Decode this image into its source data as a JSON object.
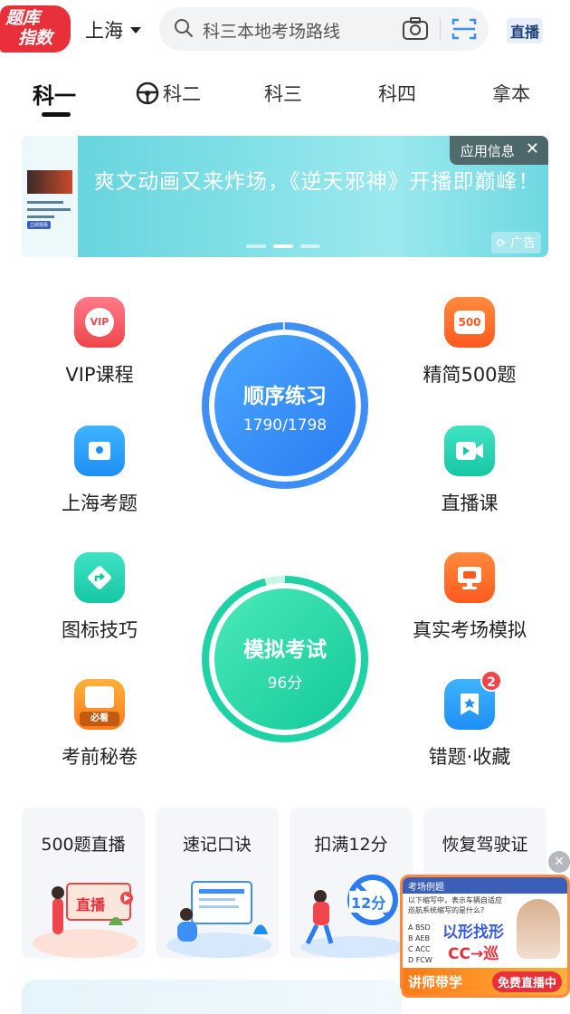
{
  "header": {
    "logo_line1": "题库",
    "logo_line2": "指数",
    "city": "上海",
    "search_placeholder": "科三本地考场路线",
    "live_label": "直播"
  },
  "tabs": [
    {
      "label": "科一",
      "active": true
    },
    {
      "label": "科二",
      "active": false
    },
    {
      "label": "科三",
      "active": false
    },
    {
      "label": "科四",
      "active": false
    },
    {
      "label": "拿本",
      "active": false
    }
  ],
  "banner": {
    "text": "爽文动画又来炸场，《逆天邪神》开播即巅峰！",
    "info_label": "应用信息",
    "close": "✕",
    "ad_label": "广告",
    "thumb_tag": "立即观看"
  },
  "features": {
    "vip": {
      "label": "VIP课程",
      "icon_text": "VIP"
    },
    "jing500": {
      "label": "精简500题",
      "icon_text": "500"
    },
    "shanghai": {
      "label": "上海考题"
    },
    "livecourse": {
      "label": "直播课"
    },
    "icons_tips": {
      "label": "图标技巧"
    },
    "real_exam": {
      "label": "真实考场模拟"
    },
    "secret": {
      "label": "考前秘卷",
      "icon_text": "必看"
    },
    "wrong": {
      "label": "错题·收藏",
      "badge": "2"
    }
  },
  "practice": {
    "title": "顺序练习",
    "progress_text": "1790/1798",
    "done": 1790,
    "total": 1798
  },
  "mock": {
    "title": "模拟考试",
    "score_text": "96分",
    "score": 96
  },
  "cards": [
    {
      "title": "500题直播",
      "art_text": "直播"
    },
    {
      "title": "速记口诀"
    },
    {
      "title": "扣满12分",
      "art_text": "12分"
    },
    {
      "title": "恢复驾驶证"
    }
  ],
  "float_live": {
    "head": "考场例题",
    "question": "以下缩写中，表示车辆自适应巡航系统缩写的是什么?",
    "options": [
      "A BSD",
      "B AEB",
      "C ACC",
      "D FCW"
    ],
    "headline": "以形找形",
    "formula": "CC→巡",
    "footer_left": "讲师带学",
    "footer_right": "免费直播中",
    "close": "✕"
  },
  "colors": {
    "brand_red": "#e8303a",
    "practice_blue": "#3d8ff5",
    "mock_green": "#1ed2a6"
  }
}
